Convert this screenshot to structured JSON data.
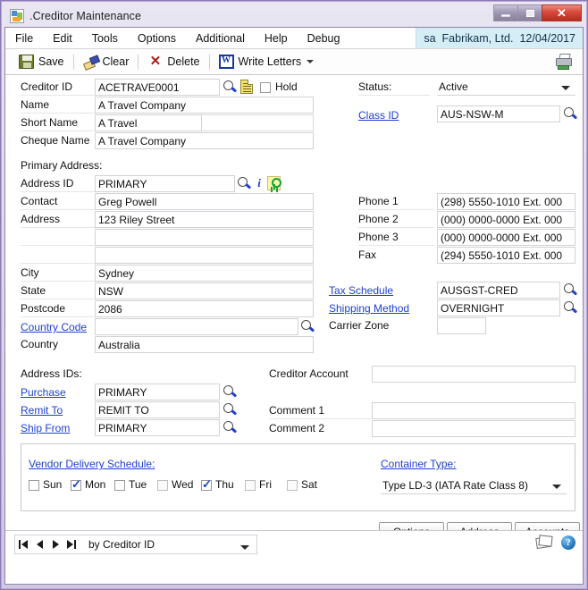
{
  "window": {
    "title": ".Creditor Maintenance",
    "app_icon": "window-app-icon",
    "minimize_label": "",
    "maximize_label": "",
    "close_label": "✕"
  },
  "menubar": {
    "items": [
      {
        "label": "File"
      },
      {
        "label": "Edit"
      },
      {
        "label": "Tools"
      },
      {
        "label": "Options"
      },
      {
        "label": "Additional"
      },
      {
        "label": "Help"
      },
      {
        "label": "Debug"
      }
    ],
    "user": "sa",
    "company": "Fabrikam, Ltd.",
    "date": "12/04/2017"
  },
  "toolbar": {
    "save_label": "Save",
    "clear_label": "Clear",
    "delete_label": "Delete",
    "write_letters_label": "Write Letters",
    "print_icon": "printer-icon"
  },
  "form": {
    "creditor_id_label": "Creditor ID",
    "creditor_id_value": "ACETRAVE0001",
    "hold_label": "Hold",
    "hold_checked": false,
    "name_label": "Name",
    "name_value": "A Travel Company",
    "short_name_label": "Short Name",
    "short_name_value": "A Travel",
    "cheque_name_label": "Cheque Name",
    "cheque_name_value": "A Travel Company",
    "status_label": "Status:",
    "status_value": "Active",
    "class_id_label": "Class ID",
    "class_id_value": "AUS-NSW-M",
    "primary_address_label": "Primary Address:",
    "address_id_label": "Address ID",
    "address_id_value": "PRIMARY",
    "contact_label": "Contact",
    "contact_value": "Greg Powell",
    "address_label": "Address",
    "address_line1": "123 Riley Street",
    "address_line2": "",
    "address_line3": "",
    "city_label": "City",
    "city_value": "Sydney",
    "state_label": "State",
    "state_value": "NSW",
    "postcode_label": "Postcode",
    "postcode_value": "2086",
    "country_code_label": "Country Code",
    "country_code_value": "",
    "country_label": "Country",
    "country_value": "Australia",
    "phone1_label": "Phone 1",
    "phone1_value": "(298) 5550-1010 Ext. 000",
    "phone2_label": "Phone 2",
    "phone2_value": "(000) 0000-0000 Ext. 000",
    "phone3_label": "Phone 3",
    "phone3_value": "(000) 0000-0000 Ext. 000",
    "fax_label": "Fax",
    "fax_value": "(294) 5550-1010 Ext. 000",
    "tax_schedule_label": "Tax Schedule",
    "tax_schedule_value": "AUSGST-CRED",
    "shipping_method_label": "Shipping Method",
    "shipping_method_value": "OVERNIGHT",
    "carrier_zone_label": "Carrier Zone",
    "carrier_zone_value": "",
    "address_ids_label": "Address IDs:",
    "purchase_label": "Purchase",
    "purchase_value": "PRIMARY",
    "remit_to_label": "Remit To",
    "remit_to_value": "REMIT TO",
    "ship_from_label": "Ship From",
    "ship_from_value": "PRIMARY",
    "creditor_account_label": "Creditor Account",
    "creditor_account_value": "",
    "comment1_label": "Comment 1",
    "comment1_value": "",
    "comment2_label": "Comment 2",
    "comment2_value": "",
    "vendor_delivery_schedule_label": "Vendor Delivery Schedule:",
    "days": [
      {
        "label": "Sun",
        "checked": false,
        "dim": false
      },
      {
        "label": "Mon",
        "checked": true,
        "dim": false
      },
      {
        "label": "Tue",
        "checked": false,
        "dim": false
      },
      {
        "label": "Wed",
        "checked": false,
        "dim": true
      },
      {
        "label": "Thu",
        "checked": true,
        "dim": false
      },
      {
        "label": "Fri",
        "checked": false,
        "dim": true
      },
      {
        "label": "Sat",
        "checked": false,
        "dim": true
      }
    ],
    "container_type_label": "Container Type:",
    "container_type_value": "Type LD-3 (IATA Rate Class 8)",
    "options_button": "Options",
    "address_button": "Address",
    "accounts_button": "Accounts"
  },
  "statusbar": {
    "sort_value": "by Creditor ID",
    "help_glyph": "?"
  },
  "colors": {
    "window_frame": "#8b79b5",
    "company_bar": "#d5edf5",
    "link": "#1d3fcf",
    "close_button": "#d6483a",
    "check": "#1745c6"
  }
}
